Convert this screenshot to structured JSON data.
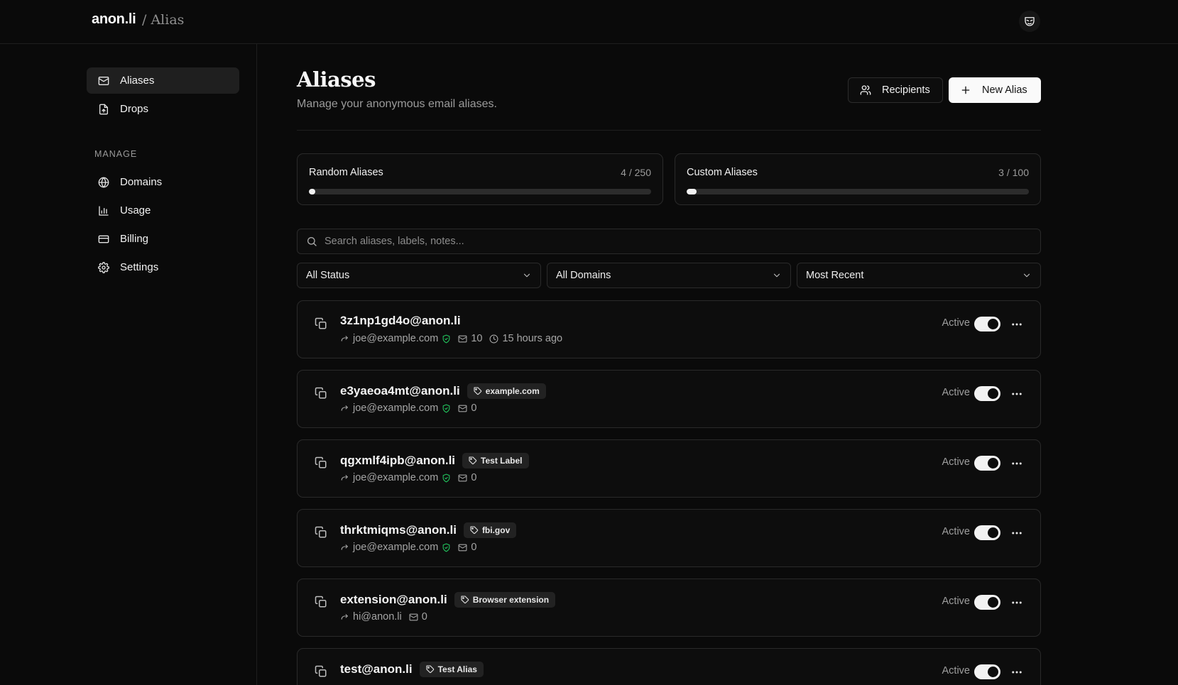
{
  "header": {
    "brand": "anon.li",
    "section": "/ Alias",
    "avatar_icon": "mask-icon"
  },
  "sidebar": {
    "primary": [
      {
        "label": "Aliases",
        "icon": "mail-icon",
        "active": true
      },
      {
        "label": "Drops",
        "icon": "file-upload-icon",
        "active": false
      }
    ],
    "section_label": "MANAGE",
    "manage": [
      {
        "label": "Domains",
        "icon": "globe-icon"
      },
      {
        "label": "Usage",
        "icon": "bar-chart-icon"
      },
      {
        "label": "Billing",
        "icon": "credit-card-icon"
      },
      {
        "label": "Settings",
        "icon": "gear-icon"
      }
    ]
  },
  "main": {
    "title": "Aliases",
    "subtitle": "Manage your anonymous email aliases.",
    "recipients_label": "Recipients",
    "new_alias_label": "New Alias"
  },
  "quotas": [
    {
      "label": "Random Aliases",
      "count": "4 / 250",
      "fraction": 0.016
    },
    {
      "label": "Custom Aliases",
      "count": "3 / 100",
      "fraction": 0.03
    }
  ],
  "search": {
    "placeholder": "Search aliases, labels, notes..."
  },
  "filters": {
    "status": "All Status",
    "domains": "All Domains",
    "sort": "Most Recent"
  },
  "colors": {
    "accent": "#fafafa",
    "background": "#0a0a0a",
    "verified": "#22c55e"
  },
  "aliases": [
    {
      "address": "3z1np1gd4o@anon.li",
      "tag": "",
      "recipient": "joe@example.com",
      "verified": true,
      "count": "10",
      "time": "15 hours ago",
      "status": "Active"
    },
    {
      "address": "e3yaeoa4mt@anon.li",
      "tag": "example.com",
      "recipient": "joe@example.com",
      "verified": true,
      "count": "0",
      "time": "",
      "status": "Active"
    },
    {
      "address": "qgxmlf4ipb@anon.li",
      "tag": "Test Label",
      "recipient": "joe@example.com",
      "verified": true,
      "count": "0",
      "time": "",
      "status": "Active"
    },
    {
      "address": "thrktmiqms@anon.li",
      "tag": "fbi.gov",
      "recipient": "joe@example.com",
      "verified": true,
      "count": "0",
      "time": "",
      "status": "Active"
    },
    {
      "address": "extension@anon.li",
      "tag": "Browser extension",
      "recipient": "hi@anon.li",
      "verified": false,
      "count": "0",
      "time": "",
      "status": "Active"
    },
    {
      "address": "test@anon.li",
      "tag": "Test Alias",
      "recipient": "",
      "verified": false,
      "count": "",
      "time": "",
      "status": "Active"
    }
  ]
}
